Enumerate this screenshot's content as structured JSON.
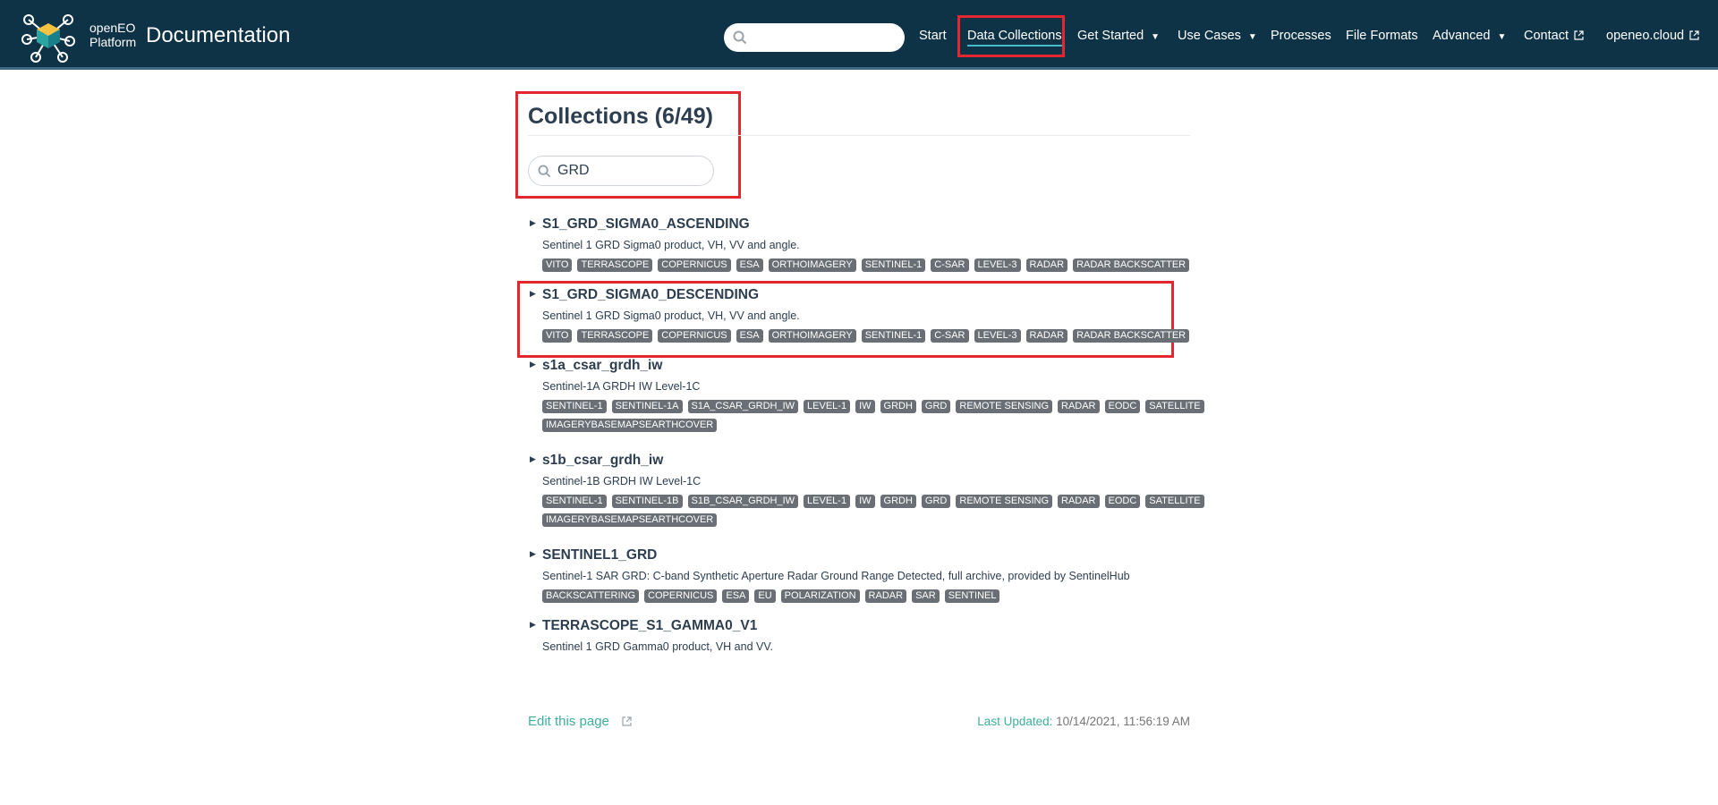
{
  "header": {
    "brand_line1": "openEO",
    "brand_line2": "Platform",
    "site_title": "Documentation",
    "search_placeholder": "",
    "nav": [
      {
        "label": "Start"
      },
      {
        "label": "Data Collections"
      },
      {
        "label": "Get Started"
      },
      {
        "label": "Use Cases"
      },
      {
        "label": "Processes"
      },
      {
        "label": "File Formats"
      },
      {
        "label": "Advanced"
      },
      {
        "label": "Contact"
      },
      {
        "label": "openeo.cloud"
      }
    ],
    "caret": "▼",
    "colors": {
      "background": "#0e3347",
      "highlight": "#e3262f",
      "active_underline": "#46bdc6"
    }
  },
  "main": {
    "title": "Collections (6/49)",
    "filter_value": "GRD",
    "collections": [
      {
        "name": "S1_GRD_SIGMA0_ASCENDING",
        "description": "Sentinel 1 GRD Sigma0 product, VH, VV and angle.",
        "tags": [
          "VITO",
          "TERRASCOPE",
          "COPERNICUS",
          "ESA",
          "ORTHOIMAGERY",
          "SENTINEL-1",
          "C-SAR",
          "LEVEL-3",
          "RADAR",
          "RADAR BACKSCATTER"
        ]
      },
      {
        "name": "S1_GRD_SIGMA0_DESCENDING",
        "description": "Sentinel 1 GRD Sigma0 product, VH, VV and angle.",
        "tags": [
          "VITO",
          "TERRASCOPE",
          "COPERNICUS",
          "ESA",
          "ORTHOIMAGERY",
          "SENTINEL-1",
          "C-SAR",
          "LEVEL-3",
          "RADAR",
          "RADAR BACKSCATTER"
        ]
      },
      {
        "name": "s1a_csar_grdh_iw",
        "description": "Sentinel-1A GRDH IW Level-1C",
        "tags": [
          "SENTINEL-1",
          "SENTINEL-1A",
          "S1A_CSAR_GRDH_IW",
          "LEVEL-1",
          "IW",
          "GRDH",
          "GRD",
          "REMOTE SENSING",
          "RADAR",
          "EODC",
          "SATELLITE",
          "IMAGERYBASEMAPSEARTHCOVER"
        ]
      },
      {
        "name": "s1b_csar_grdh_iw",
        "description": "Sentinel-1B GRDH IW Level-1C",
        "tags": [
          "SENTINEL-1",
          "SENTINEL-1B",
          "S1B_CSAR_GRDH_IW",
          "LEVEL-1",
          "IW",
          "GRDH",
          "GRD",
          "REMOTE SENSING",
          "RADAR",
          "EODC",
          "SATELLITE",
          "IMAGERYBASEMAPSEARTHCOVER"
        ]
      },
      {
        "name": "SENTINEL1_GRD",
        "description": "Sentinel-1 SAR GRD: C-band Synthetic Aperture Radar Ground Range Detected, full archive, provided by SentinelHub",
        "tags": [
          "BACKSCATTERING",
          "COPERNICUS",
          "ESA",
          "EU",
          "POLARIZATION",
          "RADAR",
          "SAR",
          "SENTINEL"
        ]
      },
      {
        "name": "TERRASCOPE_S1_GAMMA0_V1",
        "description": "Sentinel 1 GRD Gamma0 product, VH and VV.",
        "tags": []
      }
    ]
  },
  "footer": {
    "edit_link": "Edit this page",
    "last_updated_label": "Last Updated:",
    "last_updated_value": "10/14/2021, 11:56:19 AM"
  }
}
